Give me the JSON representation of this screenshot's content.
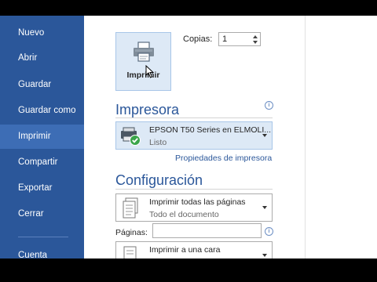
{
  "sidebar": {
    "items": [
      {
        "label": "Nuevo"
      },
      {
        "label": "Abrir"
      },
      {
        "label": "Guardar"
      },
      {
        "label": "Guardar como"
      },
      {
        "label": "Imprimir"
      },
      {
        "label": "Compartir"
      },
      {
        "label": "Exportar"
      },
      {
        "label": "Cerrar"
      },
      {
        "label": "Cuenta"
      }
    ],
    "active": "Imprimir"
  },
  "print": {
    "button_label": "Imprimir",
    "copies_label": "Copias:",
    "copies_value": "1"
  },
  "printer": {
    "section_title": "Impresora",
    "name": "EPSON T50 Series en ELMOLI...",
    "status": "Listo",
    "properties_link": "Propiedades de impresora"
  },
  "settings": {
    "section_title": "Configuración",
    "range": {
      "main": "Imprimir todas las páginas",
      "sub": "Todo el documento"
    },
    "pages_label": "Páginas:",
    "pages_value": "",
    "sides": {
      "main": "Imprimir a una cara"
    }
  },
  "colors": {
    "sidebar_bg": "#2b579a",
    "sidebar_active": "#3d6db5",
    "accent": "#2b579a",
    "status_ok": "#3aa54a"
  }
}
